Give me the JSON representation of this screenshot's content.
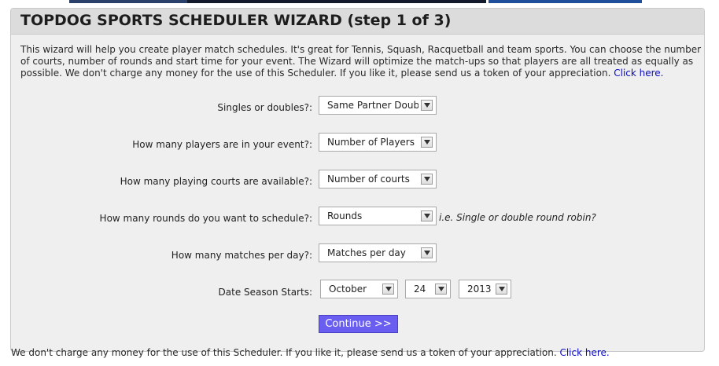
{
  "wizard": {
    "title": "TOPDOG SPORTS SCHEDULER WIZARD (step 1 of 3)",
    "intro_text": "This wizard will help you create player match schedules. It's great for Tennis, Squash, Racquetball and team sports. You can choose the number of courts, number of rounds and start time for your event. The Wizard will optimize the match-ups so that players are all treated as equally as possible. We don't charge any money for the use of this Scheduler. If you like it, please send us a token of your appreciation.",
    "intro_link": "Click here."
  },
  "form": {
    "singles": {
      "label": "Singles or doubles?:",
      "value": "Same Partner Doubl"
    },
    "players": {
      "label": "How many players are in your event?:",
      "value": "Number of Players"
    },
    "courts": {
      "label": "How many playing courts are available?:",
      "value": "Number of courts"
    },
    "rounds": {
      "label": "How many rounds do you want to schedule?:",
      "value": "Rounds",
      "hint": "i.e. Single or double round robin?"
    },
    "matches": {
      "label": "How many matches per day?:",
      "value": "Matches per day"
    },
    "season": {
      "label": "Date Season Starts:",
      "month": "October",
      "day": "24",
      "year": "2013"
    },
    "continue_label": "Continue >>"
  },
  "footer": {
    "text": "We don't charge any money for the use of this Scheduler. If you like it, please send us a token of your appreciation.",
    "link": "Click here."
  },
  "colors": {
    "continue_bg": "#6a5ef0",
    "link": "#0b0bc4",
    "panel_bg": "#efefef",
    "title_bg": "#dcdcdc"
  }
}
